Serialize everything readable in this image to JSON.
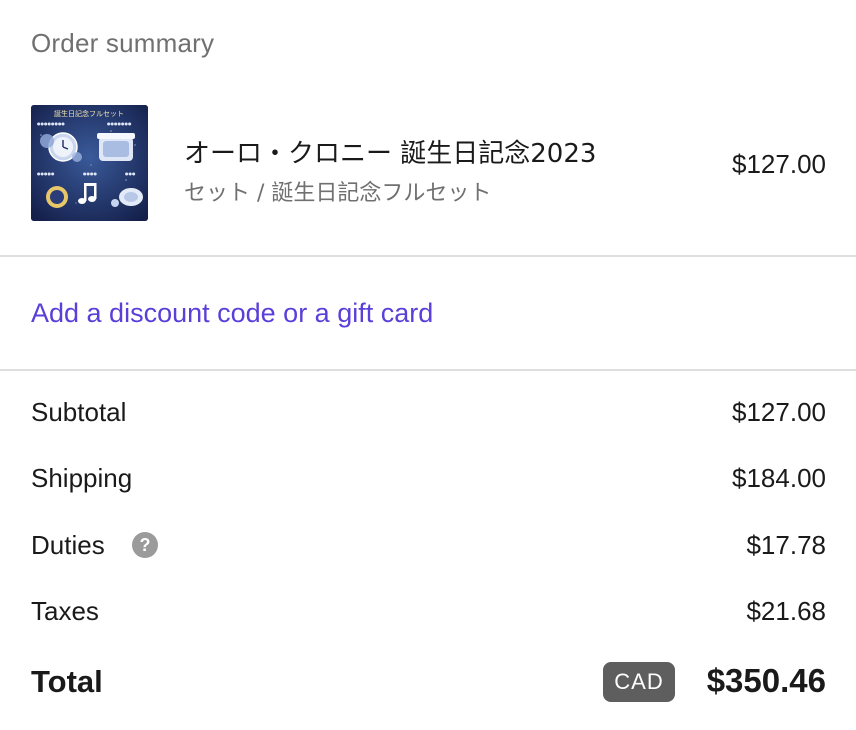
{
  "order_summary": {
    "heading": "Order summary"
  },
  "product": {
    "image_title": "誕生日記念フルセット",
    "name": "オーロ・クロニー 誕生日記念2023",
    "variant": "セット / 誕生日記念フルセット",
    "price": "$127.00",
    "image_icon": "product-thumbnail"
  },
  "discount": {
    "link_label": "Add a discount code or a gift card"
  },
  "summary": {
    "subtotal_label": "Subtotal",
    "subtotal_value": "$127.00",
    "shipping_label": "Shipping",
    "shipping_value": "$184.00",
    "duties_label": "Duties",
    "duties_help_icon": "question-circle-icon",
    "duties_value": "$17.78",
    "taxes_label": "Taxes",
    "taxes_value": "$21.68",
    "total_label": "Total",
    "currency": "CAD",
    "total_value": "$350.46"
  },
  "colors": {
    "link": "#5a3fd8",
    "muted_text": "#707070",
    "badge_bg": "#5e5e5e",
    "divider": "#dedede"
  }
}
